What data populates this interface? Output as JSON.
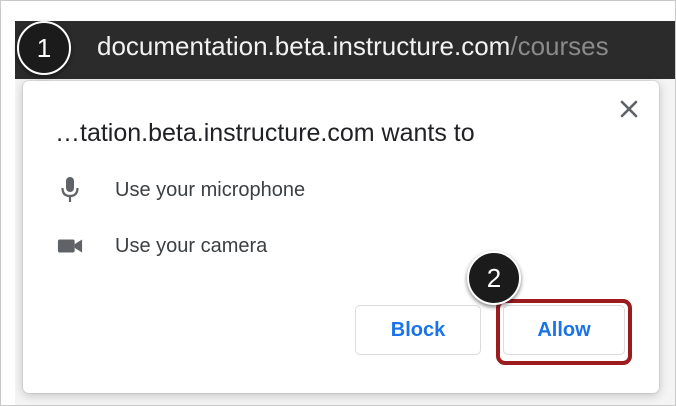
{
  "address_bar": {
    "host": "documentation.beta.instructure.com",
    "path": "/courses"
  },
  "dialog": {
    "title": "…tation.beta.instructure.com wants to",
    "permissions": [
      {
        "icon": "microphone-icon",
        "label": "Use your microphone"
      },
      {
        "icon": "camera-icon",
        "label": "Use your camera"
      }
    ],
    "block_label": "Block",
    "allow_label": "Allow",
    "close_icon": "close-icon"
  },
  "callouts": {
    "step1": "1",
    "step2": "2"
  },
  "colors": {
    "accent": "#1a73e8",
    "highlight": "#9b1b1f",
    "marker": "#1b1b1b"
  }
}
